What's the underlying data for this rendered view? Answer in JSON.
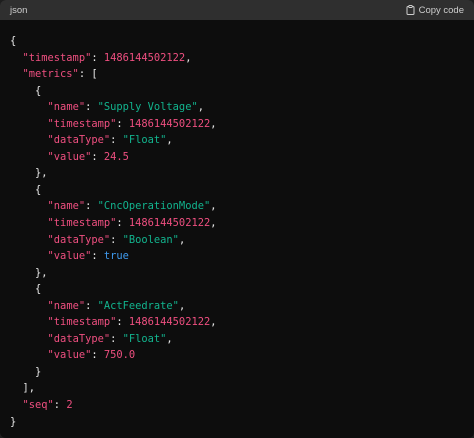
{
  "header": {
    "language": "json",
    "copy_label": "Copy code",
    "copy_icon": "clipboard-icon"
  },
  "code": {
    "timestamp_key": "\"timestamp\"",
    "timestamp_value": "1486144502122",
    "metrics_key": "\"metrics\"",
    "metrics": [
      {
        "name_key": "\"name\"",
        "name_value": "\"Supply Voltage\"",
        "timestamp_key": "\"timestamp\"",
        "timestamp_value": "1486144502122",
        "datatype_key": "\"dataType\"",
        "datatype_value": "\"Float\"",
        "value_key": "\"value\"",
        "value_value": "24.5"
      },
      {
        "name_key": "\"name\"",
        "name_value": "\"CncOperationMode\"",
        "timestamp_key": "\"timestamp\"",
        "timestamp_value": "1486144502122",
        "datatype_key": "\"dataType\"",
        "datatype_value": "\"Boolean\"",
        "value_key": "\"value\"",
        "value_value": "true"
      },
      {
        "name_key": "\"name\"",
        "name_value": "\"ActFeedrate\"",
        "timestamp_key": "\"timestamp\"",
        "timestamp_value": "1486144502122",
        "datatype_key": "\"dataType\"",
        "datatype_value": "\"Float\"",
        "value_key": "\"value\"",
        "value_value": "750.0"
      }
    ],
    "seq_key": "\"seq\"",
    "seq_value": "2"
  }
}
